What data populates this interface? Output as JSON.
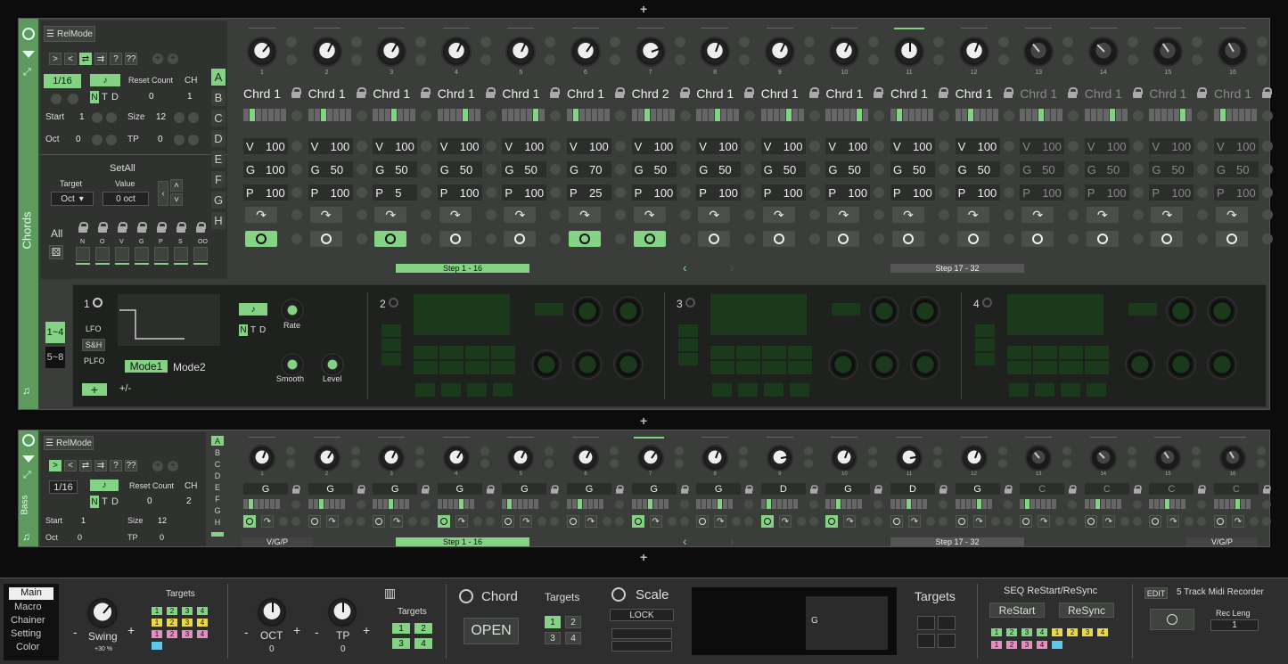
{
  "top_plus": "+",
  "chords": {
    "section_label": "Chords",
    "relmode": "RelMode",
    "nav_buttons": [
      ">",
      "<",
      "⇄",
      "⇉",
      "?",
      "??"
    ],
    "rate": "1/16",
    "reset_count_label": "Reset Count",
    "reset_count": "0",
    "ch_label": "CH",
    "ch": "1",
    "ntd": [
      "N",
      "T",
      "D"
    ],
    "start_label": "Start",
    "start": "1",
    "size_label": "Size",
    "size": "12",
    "oct_label": "Oct",
    "oct": "0",
    "tp_label": "TP",
    "tp": "0",
    "setall": "SetAll",
    "target_label": "Target",
    "value_label": "Value",
    "target": "Oct",
    "value": "0 oct",
    "all": "All",
    "lock_labels": [
      "N",
      "O",
      "V",
      "G",
      "P",
      "S",
      "OO"
    ],
    "letters": [
      "A",
      "B",
      "C",
      "D",
      "E",
      "F",
      "G",
      "H"
    ],
    "steps": [
      {
        "n": "1",
        "chord": "Chrd 1",
        "v": "100",
        "g": "100",
        "p": "100",
        "pw": true,
        "dim": false
      },
      {
        "n": "2",
        "chord": "Chrd 1",
        "v": "100",
        "g": "50",
        "p": "100",
        "pw": false,
        "dim": false
      },
      {
        "n": "3",
        "chord": "Chrd 1",
        "v": "100",
        "g": "50",
        "p": "5",
        "pw": true,
        "dim": false
      },
      {
        "n": "4",
        "chord": "Chrd 1",
        "v": "100",
        "g": "50",
        "p": "100",
        "pw": false,
        "dim": false
      },
      {
        "n": "5",
        "chord": "Chrd 1",
        "v": "100",
        "g": "50",
        "p": "100",
        "pw": false,
        "dim": false
      },
      {
        "n": "6",
        "chord": "Chrd 1",
        "v": "100",
        "g": "70",
        "p": "25",
        "pw": true,
        "dim": false
      },
      {
        "n": "7",
        "chord": "Chrd 2",
        "v": "100",
        "g": "50",
        "p": "100",
        "pw": true,
        "dim": false
      },
      {
        "n": "8",
        "chord": "Chrd 1",
        "v": "100",
        "g": "50",
        "p": "100",
        "pw": false,
        "dim": false
      },
      {
        "n": "9",
        "chord": "Chrd 1",
        "v": "100",
        "g": "50",
        "p": "100",
        "pw": false,
        "dim": false
      },
      {
        "n": "10",
        "chord": "Chrd 1",
        "v": "100",
        "g": "50",
        "p": "100",
        "pw": false,
        "dim": false
      },
      {
        "n": "11",
        "chord": "Chrd 1",
        "v": "100",
        "g": "50",
        "p": "100",
        "pw": false,
        "dim": false
      },
      {
        "n": "12",
        "chord": "Chrd 1",
        "v": "100",
        "g": "50",
        "p": "100",
        "pw": false,
        "dim": false
      },
      {
        "n": "13",
        "chord": "Chrd 1",
        "v": "100",
        "g": "50",
        "p": "100",
        "pw": false,
        "dim": true
      },
      {
        "n": "14",
        "chord": "Chrd 1",
        "v": "100",
        "g": "50",
        "p": "100",
        "pw": false,
        "dim": true
      },
      {
        "n": "15",
        "chord": "Chrd 1",
        "v": "100",
        "g": "50",
        "p": "100",
        "pw": false,
        "dim": true
      },
      {
        "n": "16",
        "chord": "Chrd 1",
        "v": "100",
        "g": "50",
        "p": "100",
        "pw": false,
        "dim": true
      }
    ],
    "v_letter": "V",
    "g_letter": "G",
    "p_letter": "P",
    "step_a": "Step   1 - 16",
    "step_b": "Step   17 - 32",
    "mod": {
      "r14": "1~4",
      "r58": "5~8",
      "lfo": "LFO",
      "sh": "S&H",
      "plfo": "PLFO",
      "mode1": "Mode1",
      "mode2": "Mode2",
      "pm": "+/-",
      "rate": "Rate",
      "smooth": "Smooth",
      "level": "Level",
      "n1": "1",
      "n2": "2",
      "n3": "3",
      "n4": "4"
    }
  },
  "bass": {
    "section_label": "Bass",
    "relmode": "RelMode",
    "rate": "1/16",
    "reset_count_label": "Reset Count",
    "reset_count": "0",
    "ch_label": "CH",
    "ch": "2",
    "start_label": "Start",
    "start": "1",
    "size_label": "Size",
    "size": "12",
    "oct_label": "Oct",
    "oct": "0",
    "tp_label": "TP",
    "tp": "0",
    "notes": [
      "G",
      "G",
      "G",
      "G",
      "G",
      "G",
      "G",
      "G",
      "D",
      "G",
      "D",
      "G",
      "C",
      "C",
      "C",
      "C"
    ],
    "vgp": "V/G/P",
    "step_a": "Step   1 - 16",
    "step_b": "Step   17 - 32"
  },
  "bottom": {
    "menu": [
      "Main",
      "Macro",
      "Chainer",
      "Setting",
      "Color"
    ],
    "swing": "Swing",
    "swing_val": "+30 %",
    "targets": "Targets",
    "oct": "OCT",
    "oct_val": "0",
    "tp": "TP",
    "tp_val": "0",
    "chord": "Chord",
    "open": "OPEN",
    "scale": "Scale",
    "lock": "LOCK",
    "scale_note": "G",
    "seq_title": "SEQ ReStart/ReSync",
    "restart": "ReStart",
    "resync": "ReSync",
    "edit": "EDIT",
    "recorder": "5 Track Midi Recorder",
    "rec_leng": "Rec Leng",
    "rec_val": "1"
  },
  "accent": "#84d384"
}
